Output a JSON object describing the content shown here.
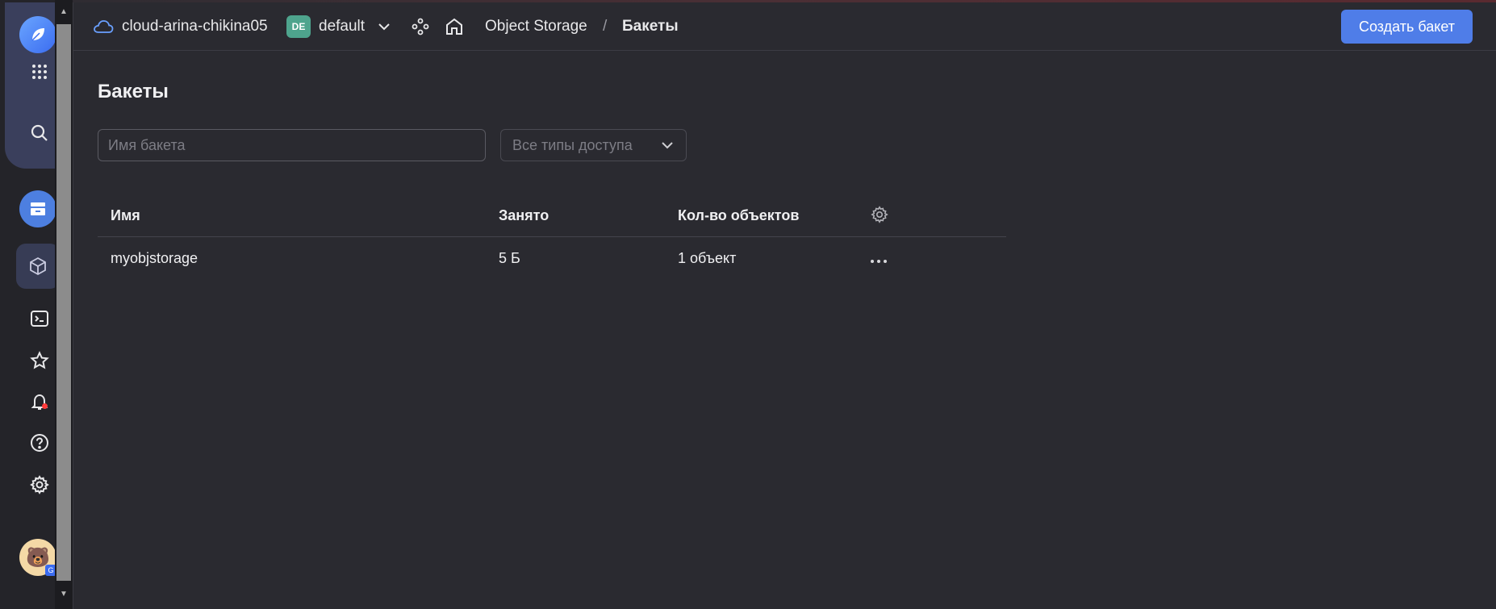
{
  "header": {
    "cloud_name": "cloud-arina-chikina05",
    "folder_badge": "DE",
    "folder_name": "default",
    "breadcrumb": {
      "service": "Object Storage",
      "separator": "/",
      "current": "Бакеты"
    },
    "create_button": "Создать бакет"
  },
  "page": {
    "title": "Бакеты",
    "search_placeholder": "Имя бакета",
    "search_value": "",
    "access_filter": "Все типы доступа"
  },
  "table": {
    "columns": [
      "Имя",
      "Занято",
      "Кол-во объектов"
    ],
    "rows": [
      {
        "name": "myobjstorage",
        "size": "5 Б",
        "objects": "1 объект"
      }
    ]
  },
  "rail": {
    "icons": [
      "logo-icon",
      "apps-grid-icon",
      "search-icon",
      "storage-service-icon",
      "cube-icon",
      "terminal-icon",
      "star-icon",
      "bell-icon",
      "help-icon",
      "gear-icon",
      "avatar"
    ]
  },
  "colors": {
    "background": "#2a2a30",
    "accent": "#4f7de8",
    "badge": "#4ea48d"
  }
}
